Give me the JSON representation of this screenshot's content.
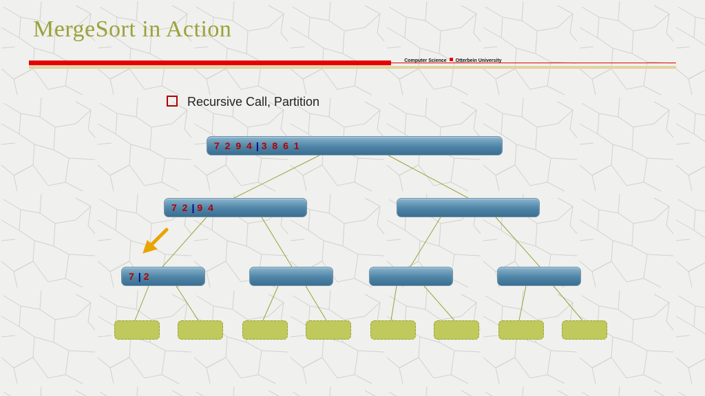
{
  "title": "MergeSort in Action",
  "divider": {
    "dept": "Computer Science",
    "school": "Otterbein University"
  },
  "bullet": "Recursive Call, Partition",
  "root": {
    "left": "7 2 9 4",
    "right": "3 8 6 1"
  },
  "l2a": {
    "left": "7 2",
    "right": "9 4"
  },
  "l3a": {
    "left": "7",
    "right": "2"
  },
  "colors": {
    "accent": "#9aa23a",
    "alert": "#e60000",
    "node_text": "#b00000",
    "bar": "#00008b",
    "arrow": "#e8a400"
  }
}
